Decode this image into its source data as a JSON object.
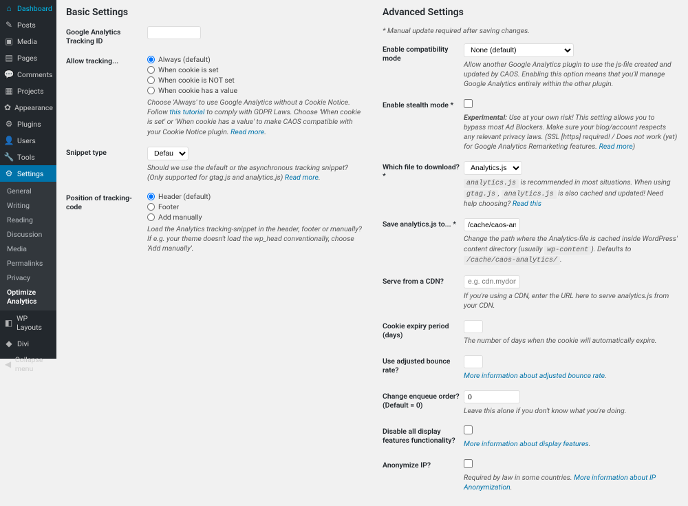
{
  "sidebar": {
    "items": [
      {
        "label": "Dashboard",
        "icon": "⌂"
      },
      {
        "label": "Posts",
        "icon": "✎"
      },
      {
        "label": "Media",
        "icon": "▣"
      },
      {
        "label": "Pages",
        "icon": "▤"
      },
      {
        "label": "Comments",
        "icon": "💬"
      },
      {
        "label": "Projects",
        "icon": "▦"
      },
      {
        "label": "Appearance",
        "icon": "✿"
      },
      {
        "label": "Plugins",
        "icon": "⚙"
      },
      {
        "label": "Users",
        "icon": "👤"
      },
      {
        "label": "Tools",
        "icon": "🔧"
      },
      {
        "label": "Settings",
        "icon": "⚙",
        "current": true
      }
    ],
    "submenu": [
      {
        "label": "General"
      },
      {
        "label": "Writing"
      },
      {
        "label": "Reading"
      },
      {
        "label": "Discussion"
      },
      {
        "label": "Media"
      },
      {
        "label": "Permalinks"
      },
      {
        "label": "Privacy"
      },
      {
        "label": "Optimize Analytics",
        "active": true
      }
    ],
    "after": [
      {
        "label": "WP Layouts",
        "icon": "◧"
      },
      {
        "label": "Divi",
        "icon": "◆"
      }
    ],
    "collapse": "Collapse menu"
  },
  "basic": {
    "title": "Basic Settings",
    "tracking_id_label": "Google Analytics Tracking ID",
    "allow_tracking_label": "Allow tracking...",
    "tracking_opts": [
      "Always (default)",
      "When cookie is set",
      "When cookie is NOT set",
      "When cookie has a value"
    ],
    "tracking_desc_1": "Choose 'Always' to use Google Analytics without a Cookie Notice. Follow ",
    "tracking_link": "this tutorial",
    "tracking_desc_2": " to comply with GDPR Laws. Choose 'When cookie is set' or 'When cookie has a value' to make CAOS compatible with your Cookie Notice plugin. ",
    "read_more": "Read more",
    "snippet_label": "Snippet type",
    "snippet_value": "Default",
    "snippet_desc": "Should we use the default or the asynchronous tracking snippet? (Only supported for gtag.js and analytics.js) ",
    "position_label": "Position of tracking-code",
    "position_opts": [
      "Header (default)",
      "Footer",
      "Add manually"
    ],
    "position_desc": "Load the Analytics tracking-snippet in the header, footer or manually? If e.g. your theme doesn't load the wp_head conventionally, choose 'Add manually'."
  },
  "advanced": {
    "title": "Advanced Settings",
    "subnote": "* Manual update required after saving changes.",
    "compat_label": "Enable compatibility mode",
    "compat_value": "None (default)",
    "compat_desc": "Allow another Google Analytics plugin to use the js-file created and updated by CAOS. Enabling this option means that you'll manage Google Analytics entirely within the other plugin.",
    "stealth_label": "Enable stealth mode *",
    "stealth_strong": "Experimental:",
    "stealth_desc": " Use at your own risk! This setting allows you to bypass most Ad Blockers. Make sure your blog/account respects any relevant privacy laws. (SSL [https] required! / Does not work (yet) for Google Analytics Remarketing features. ",
    "file_label": "Which file to download? *",
    "file_value": "Analytics.js (default)",
    "file_code1": "analytics.js",
    "file_desc_mid": " is recommended in most situations. When using ",
    "file_code2": "gtag.js",
    "file_code3": "analytics.js",
    "file_desc_end": " is also cached and updated! Need help choosing? ",
    "file_link": "Read this",
    "save_label": "Save analytics.js to... *",
    "save_value": "/cache/caos-analytics/",
    "save_desc_1": "Change the path where the Analytics-file is cached inside WordPress' content directory (usually ",
    "save_code1": "wp-content",
    "save_desc_2": "). Defaults to ",
    "save_code2": "/cache/caos-analytics/",
    "cdn_label": "Serve from a CDN?",
    "cdn_placeholder": "e.g. cdn.mydomain.com",
    "cdn_desc": "If you're using a CDN, enter the URL here to serve analytics.js from your CDN.",
    "cookie_label": "Cookie expiry period (days)",
    "cookie_desc": "The number of days when the cookie will automatically expire.",
    "bounce_label": "Use adjusted bounce rate?",
    "bounce_link": "More information about adjusted bounce rate",
    "enqueue_label": "Change enqueue order? (Default = 0)",
    "enqueue_value": "0",
    "enqueue_desc": "Leave this alone if you don't know what you're doing.",
    "display_label": "Disable all display features functionality?",
    "display_link": "More information about display features",
    "anon_label": "Anonymize IP?",
    "anon_desc": "Required by law in some countries. ",
    "anon_link": "More information about IP Anonymization"
  }
}
